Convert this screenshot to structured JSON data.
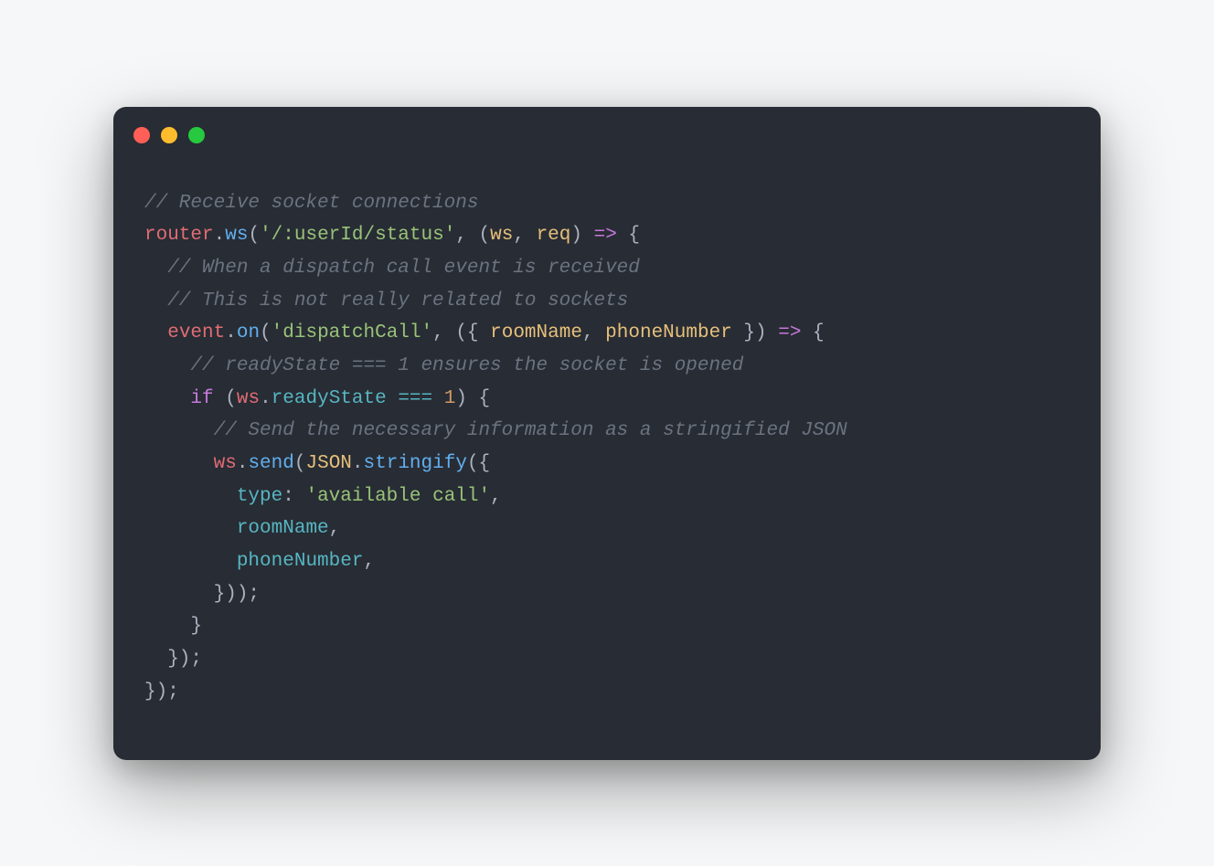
{
  "colors": {
    "background": "#282c34",
    "close": "#ff5f56",
    "minimize": "#ffbd2e",
    "maximize": "#27c93f",
    "page": "#f6f7f8"
  },
  "code": {
    "c1": "// Receive socket connections",
    "l2_ident1": "router",
    "l2_dot1": ".",
    "l2_method": "ws",
    "l2_open": "(",
    "l2_string": "'/:userId/status'",
    "l2_comma": ", (",
    "l2_p1": "ws",
    "l2_pcomma": ", ",
    "l2_p2": "req",
    "l2_close": ") ",
    "l2_arrow": "=>",
    "l2_brace": " {",
    "c3": "  // When a dispatch call event is received",
    "c4": "  // This is not really related to sockets",
    "l5_indent": "  ",
    "l5_ident": "event",
    "l5_dot": ".",
    "l5_method": "on",
    "l5_open": "(",
    "l5_string": "'dispatchCall'",
    "l5_comma": ", ({ ",
    "l5_p1": "roomName",
    "l5_pcomma": ", ",
    "l5_p2": "phoneNumber",
    "l5_close": " }) ",
    "l5_arrow": "=>",
    "l5_brace": " {",
    "c6": "    // readyState === 1 ensures the socket is opened",
    "l7_indent": "    ",
    "l7_if": "if",
    "l7_open": " (",
    "l7_ws": "ws",
    "l7_dot": ".",
    "l7_prop": "readyState",
    "l7_eq": " === ",
    "l7_num": "1",
    "l7_close": ") {",
    "c8": "      // Send the necessary information as a stringified JSON",
    "l9_indent": "      ",
    "l9_ws": "ws",
    "l9_dot": ".",
    "l9_send": "send",
    "l9_open": "(",
    "l9_json": "JSON",
    "l9_dot2": ".",
    "l9_stringify": "stringify",
    "l9_open2": "({",
    "l10_indent": "        ",
    "l10_key": "type",
    "l10_colon": ": ",
    "l10_val": "'available call'",
    "l10_comma": ",",
    "l11_indent": "        ",
    "l11_key": "roomName",
    "l11_comma": ",",
    "l12_indent": "        ",
    "l12_key": "phoneNumber",
    "l12_comma": ",",
    "l13": "      }));",
    "l14": "    }",
    "l15": "  });",
    "l16": "});"
  }
}
